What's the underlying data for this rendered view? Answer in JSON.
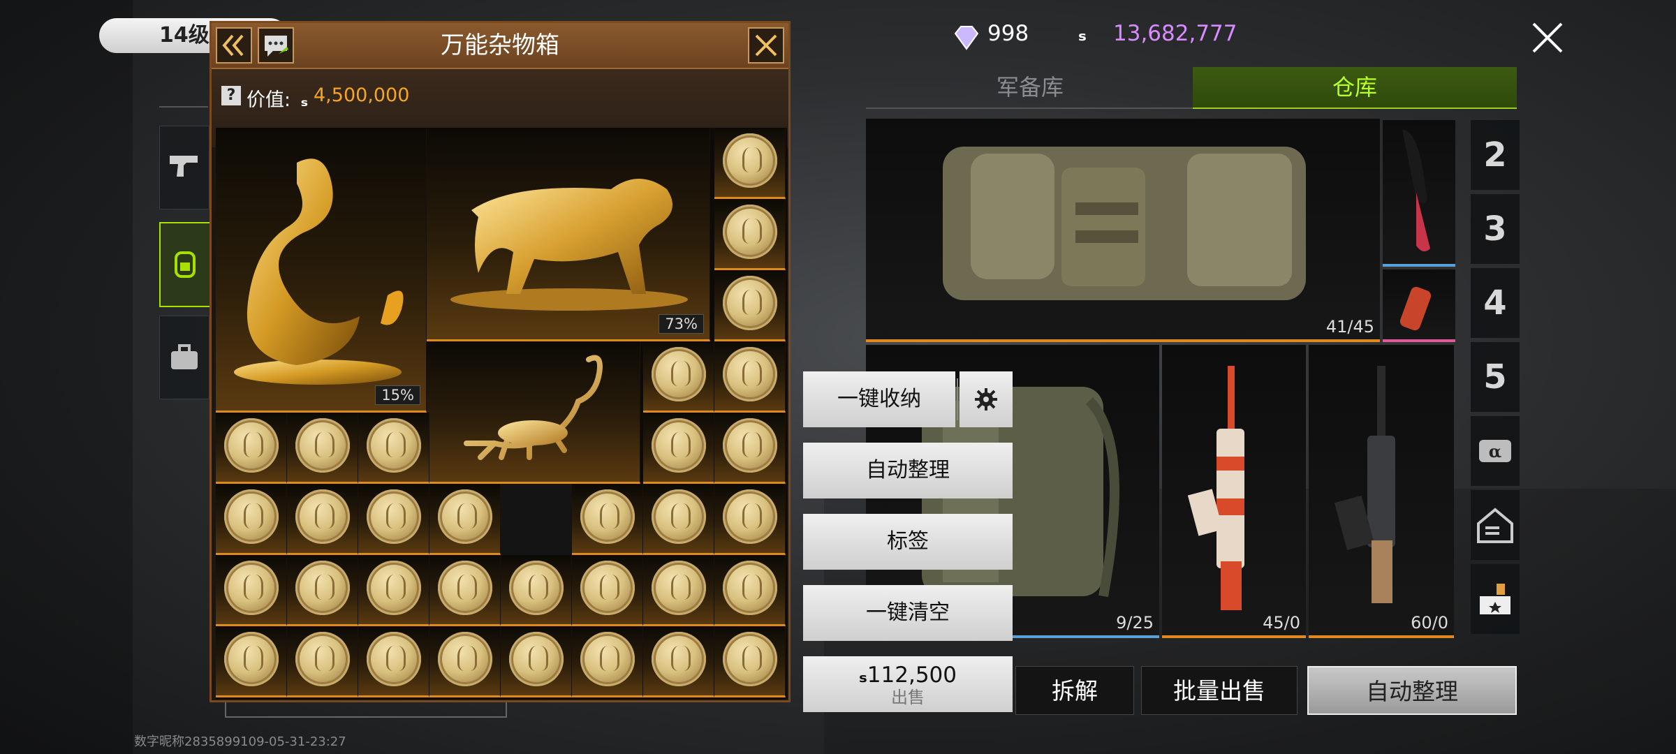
{
  "level_label": "14级",
  "crate": {
    "title": "万能杂物箱",
    "value_label": "价值:",
    "value_amount": "4,500,000",
    "items": [
      {
        "name": "dragon",
        "percent": "15%"
      },
      {
        "name": "tiger",
        "percent": "73%"
      },
      {
        "name": "scorpion"
      }
    ]
  },
  "currency": {
    "diamonds": "998",
    "coins": "13,682,777"
  },
  "tabs": {
    "armory": "军备库",
    "warehouse": "仓库"
  },
  "warehouse": {
    "backpack_count": "41/45",
    "vest_count": "9/25",
    "rifle1_count": "45/0",
    "rifle2_count": "60/0",
    "side_numbers": [
      "2",
      "3",
      "4",
      "5"
    ]
  },
  "menu": {
    "one_click_store": "一键收纳",
    "auto_sort": "自动整理",
    "tag": "标签",
    "one_click_clear": "一键清空",
    "sell_amount": "112,500",
    "sell_label": "出售"
  },
  "bottom_buttons": {
    "dismantle": "拆解",
    "bulk_sell": "批量出售",
    "auto_sort": "自动整理"
  },
  "watermark": "数字昵称2835899109-05-31-23:27",
  "colors": {
    "accent_green": "#a8e000",
    "value_orange": "#f5a623",
    "coin_purple": "#d98cff"
  }
}
